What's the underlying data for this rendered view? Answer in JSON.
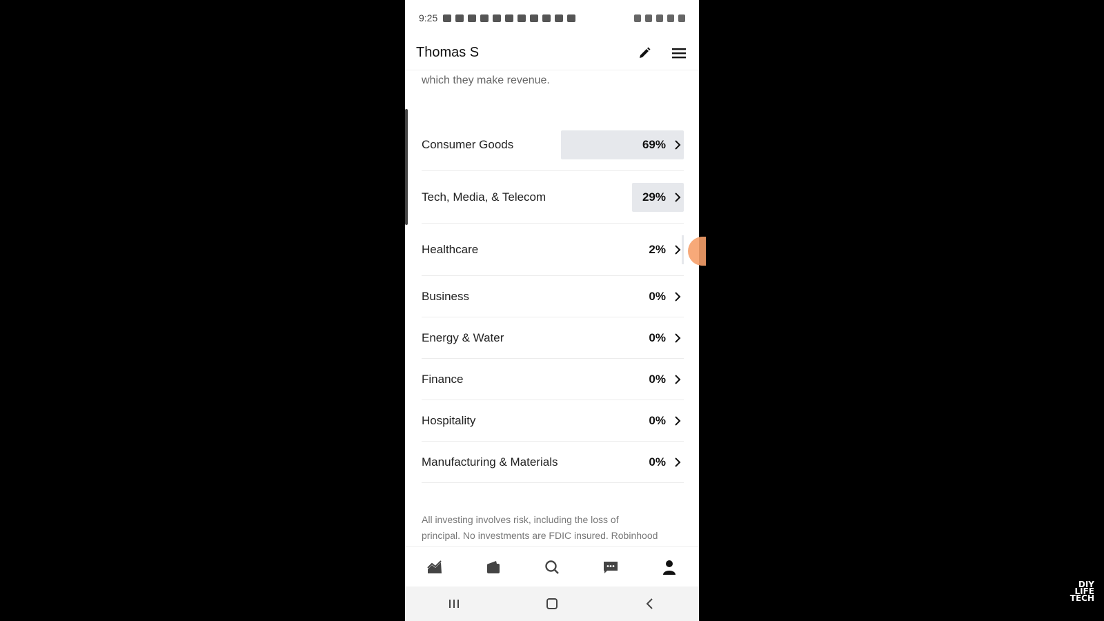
{
  "status_bar": {
    "time": "9:25"
  },
  "header": {
    "title": "Thomas S",
    "edit_icon": "pencil-icon",
    "menu_icon": "hamburger-menu-icon"
  },
  "content": {
    "intro_text": "which they make revenue.",
    "sectors": [
      {
        "name": "Consumer Goods",
        "percent": "69%",
        "value": 69
      },
      {
        "name": "Tech, Media, & Telecom",
        "percent": "29%",
        "value": 29
      },
      {
        "name": "Healthcare",
        "percent": "2%",
        "value": 2
      },
      {
        "name": "Business",
        "percent": "0%",
        "value": 0
      },
      {
        "name": "Energy & Water",
        "percent": "0%",
        "value": 0
      },
      {
        "name": "Finance",
        "percent": "0%",
        "value": 0
      },
      {
        "name": "Hospitality",
        "percent": "0%",
        "value": 0
      },
      {
        "name": "Manufacturing & Materials",
        "percent": "0%",
        "value": 0
      }
    ],
    "disclaimer_line1": "All investing involves risk, including the loss of",
    "disclaimer_line2": "principal.  No investments are FDIC insured. Robinhood"
  },
  "bottom_nav": {
    "items": [
      "chart-icon",
      "wallet-icon",
      "search-icon",
      "messages-icon",
      "profile-icon"
    ]
  },
  "system_nav": {
    "items": [
      "recents-icon",
      "home-icon",
      "back-icon"
    ]
  },
  "watermark": {
    "line1": "DIY",
    "line2": "LIFE",
    "line3": "TECH"
  },
  "colors": {
    "bar_fill": "#e6e8ec",
    "text_primary": "#111111",
    "text_muted": "#777777"
  }
}
